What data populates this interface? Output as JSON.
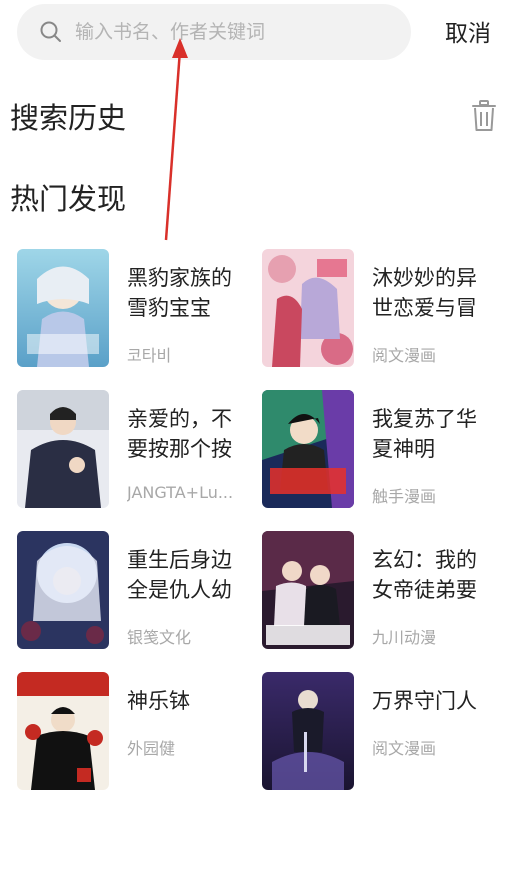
{
  "search": {
    "placeholder": "输入书名、作者关键词",
    "cancel_label": "取消"
  },
  "sections": {
    "history_title": "搜索历史",
    "hot_title": "热门发现"
  },
  "books": [
    {
      "title": "黑豹家族的雪豹宝宝",
      "author": "코타비"
    },
    {
      "title": "沐妙妙的异世恋爱与冒",
      "author": "阅文漫画"
    },
    {
      "title": "亲爱的，不要按那个按",
      "author": "JANGTA+Lu..."
    },
    {
      "title": "我复苏了华夏神明",
      "author": "触手漫画"
    },
    {
      "title": "重生后身边全是仇人幼",
      "author": "银笺文化"
    },
    {
      "title": "玄幻：我的女帝徒弟要",
      "author": "九川动漫"
    },
    {
      "title": "神乐钵",
      "author": "外园健"
    },
    {
      "title": "万界守门人",
      "author": "阅文漫画"
    }
  ],
  "colors": {
    "search_bg": "#f2f2f2",
    "placeholder": "#b4b4b4",
    "secondary_text": "#a8a8a8",
    "annotation_arrow": "#d9302a"
  },
  "icons": [
    "search-icon",
    "trash-icon"
  ]
}
